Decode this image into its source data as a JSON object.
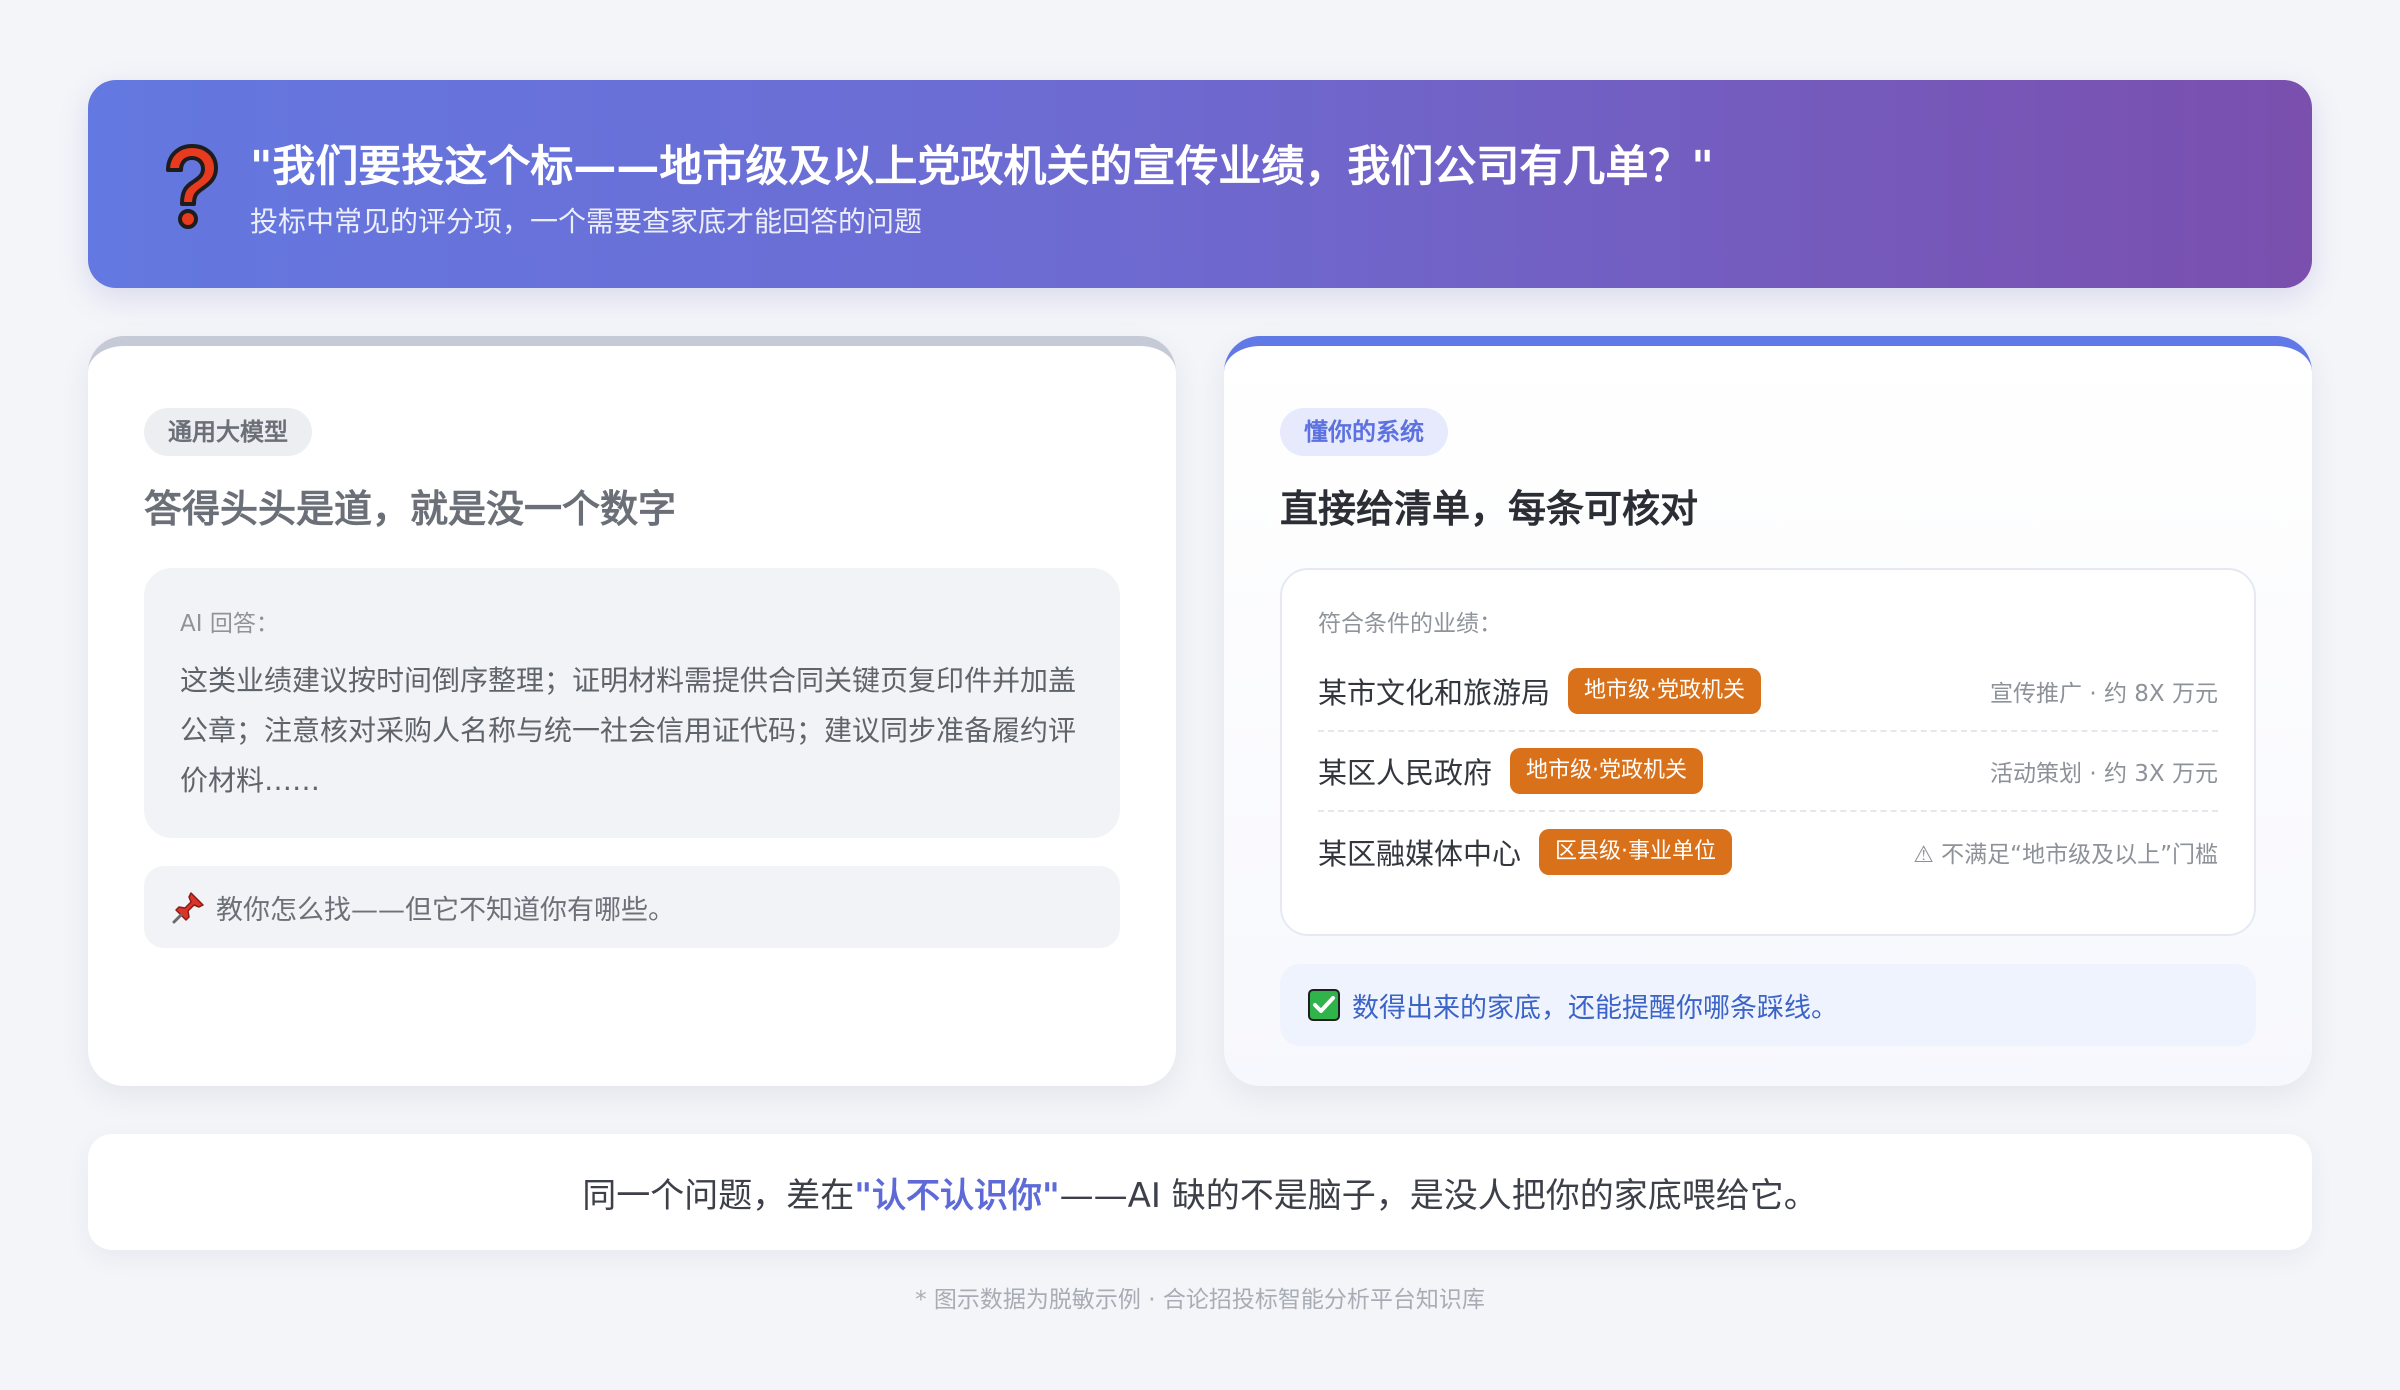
{
  "banner": {
    "icon": "question-mark-icon",
    "title": "\"我们要投这个标——地市级及以上党政机关的宣传业绩，我们公司有几单？\"",
    "subtitle": "投标中常见的评分项，一个需要查家底才能回答的问题"
  },
  "left_card": {
    "badge": "通用大模型",
    "heading": "答得头头是道，就是没一个数字",
    "answer_label": "AI 回答：",
    "answer_text": "这类业绩建议按时间倒序整理；证明材料需提供合同关键页复印件并加盖公章；注意核对采购人名称与统一社会信用证代码；建议同步准备履约评价材料……",
    "tip_icon": "pushpin-icon",
    "tip_text": "教你怎么找——但它不知道你有哪些。"
  },
  "right_card": {
    "badge": "懂你的系统",
    "heading": "直接给清单，每条可核对",
    "list_label": "符合条件的业绩：",
    "rows": [
      {
        "name": "某市文化和旅游局",
        "tag": "地市级·党政机关",
        "note": "宣传推广 · 约 8X 万元"
      },
      {
        "name": "某区人民政府",
        "tag": "地市级·党政机关",
        "note": "活动策划 · 约 3X 万元"
      },
      {
        "name": "某区融媒体中心",
        "tag": "区县级·事业单位",
        "note": "⚠ 不满足“地市级及以上”门槛"
      }
    ],
    "ok_icon": "check-mark-icon",
    "ok_text": "数得出来的家底，还能提醒你哪条踩线。"
  },
  "summary": {
    "prefix": "同一个问题，差在",
    "emphasis": "\"认不认识你\"",
    "suffix": "——AI 缺的不是脑子，是没人把你的家底喂给它。"
  },
  "footnote": "* 图示数据为脱敏示例 · 合论招投标智能分析平台知识库",
  "colors": {
    "banner_start": "#6378e0",
    "banner_end": "#7a4fae",
    "tag_orange": "#d9711a",
    "accent_blue": "#6179e6",
    "emphasis": "#5d6ad8"
  }
}
